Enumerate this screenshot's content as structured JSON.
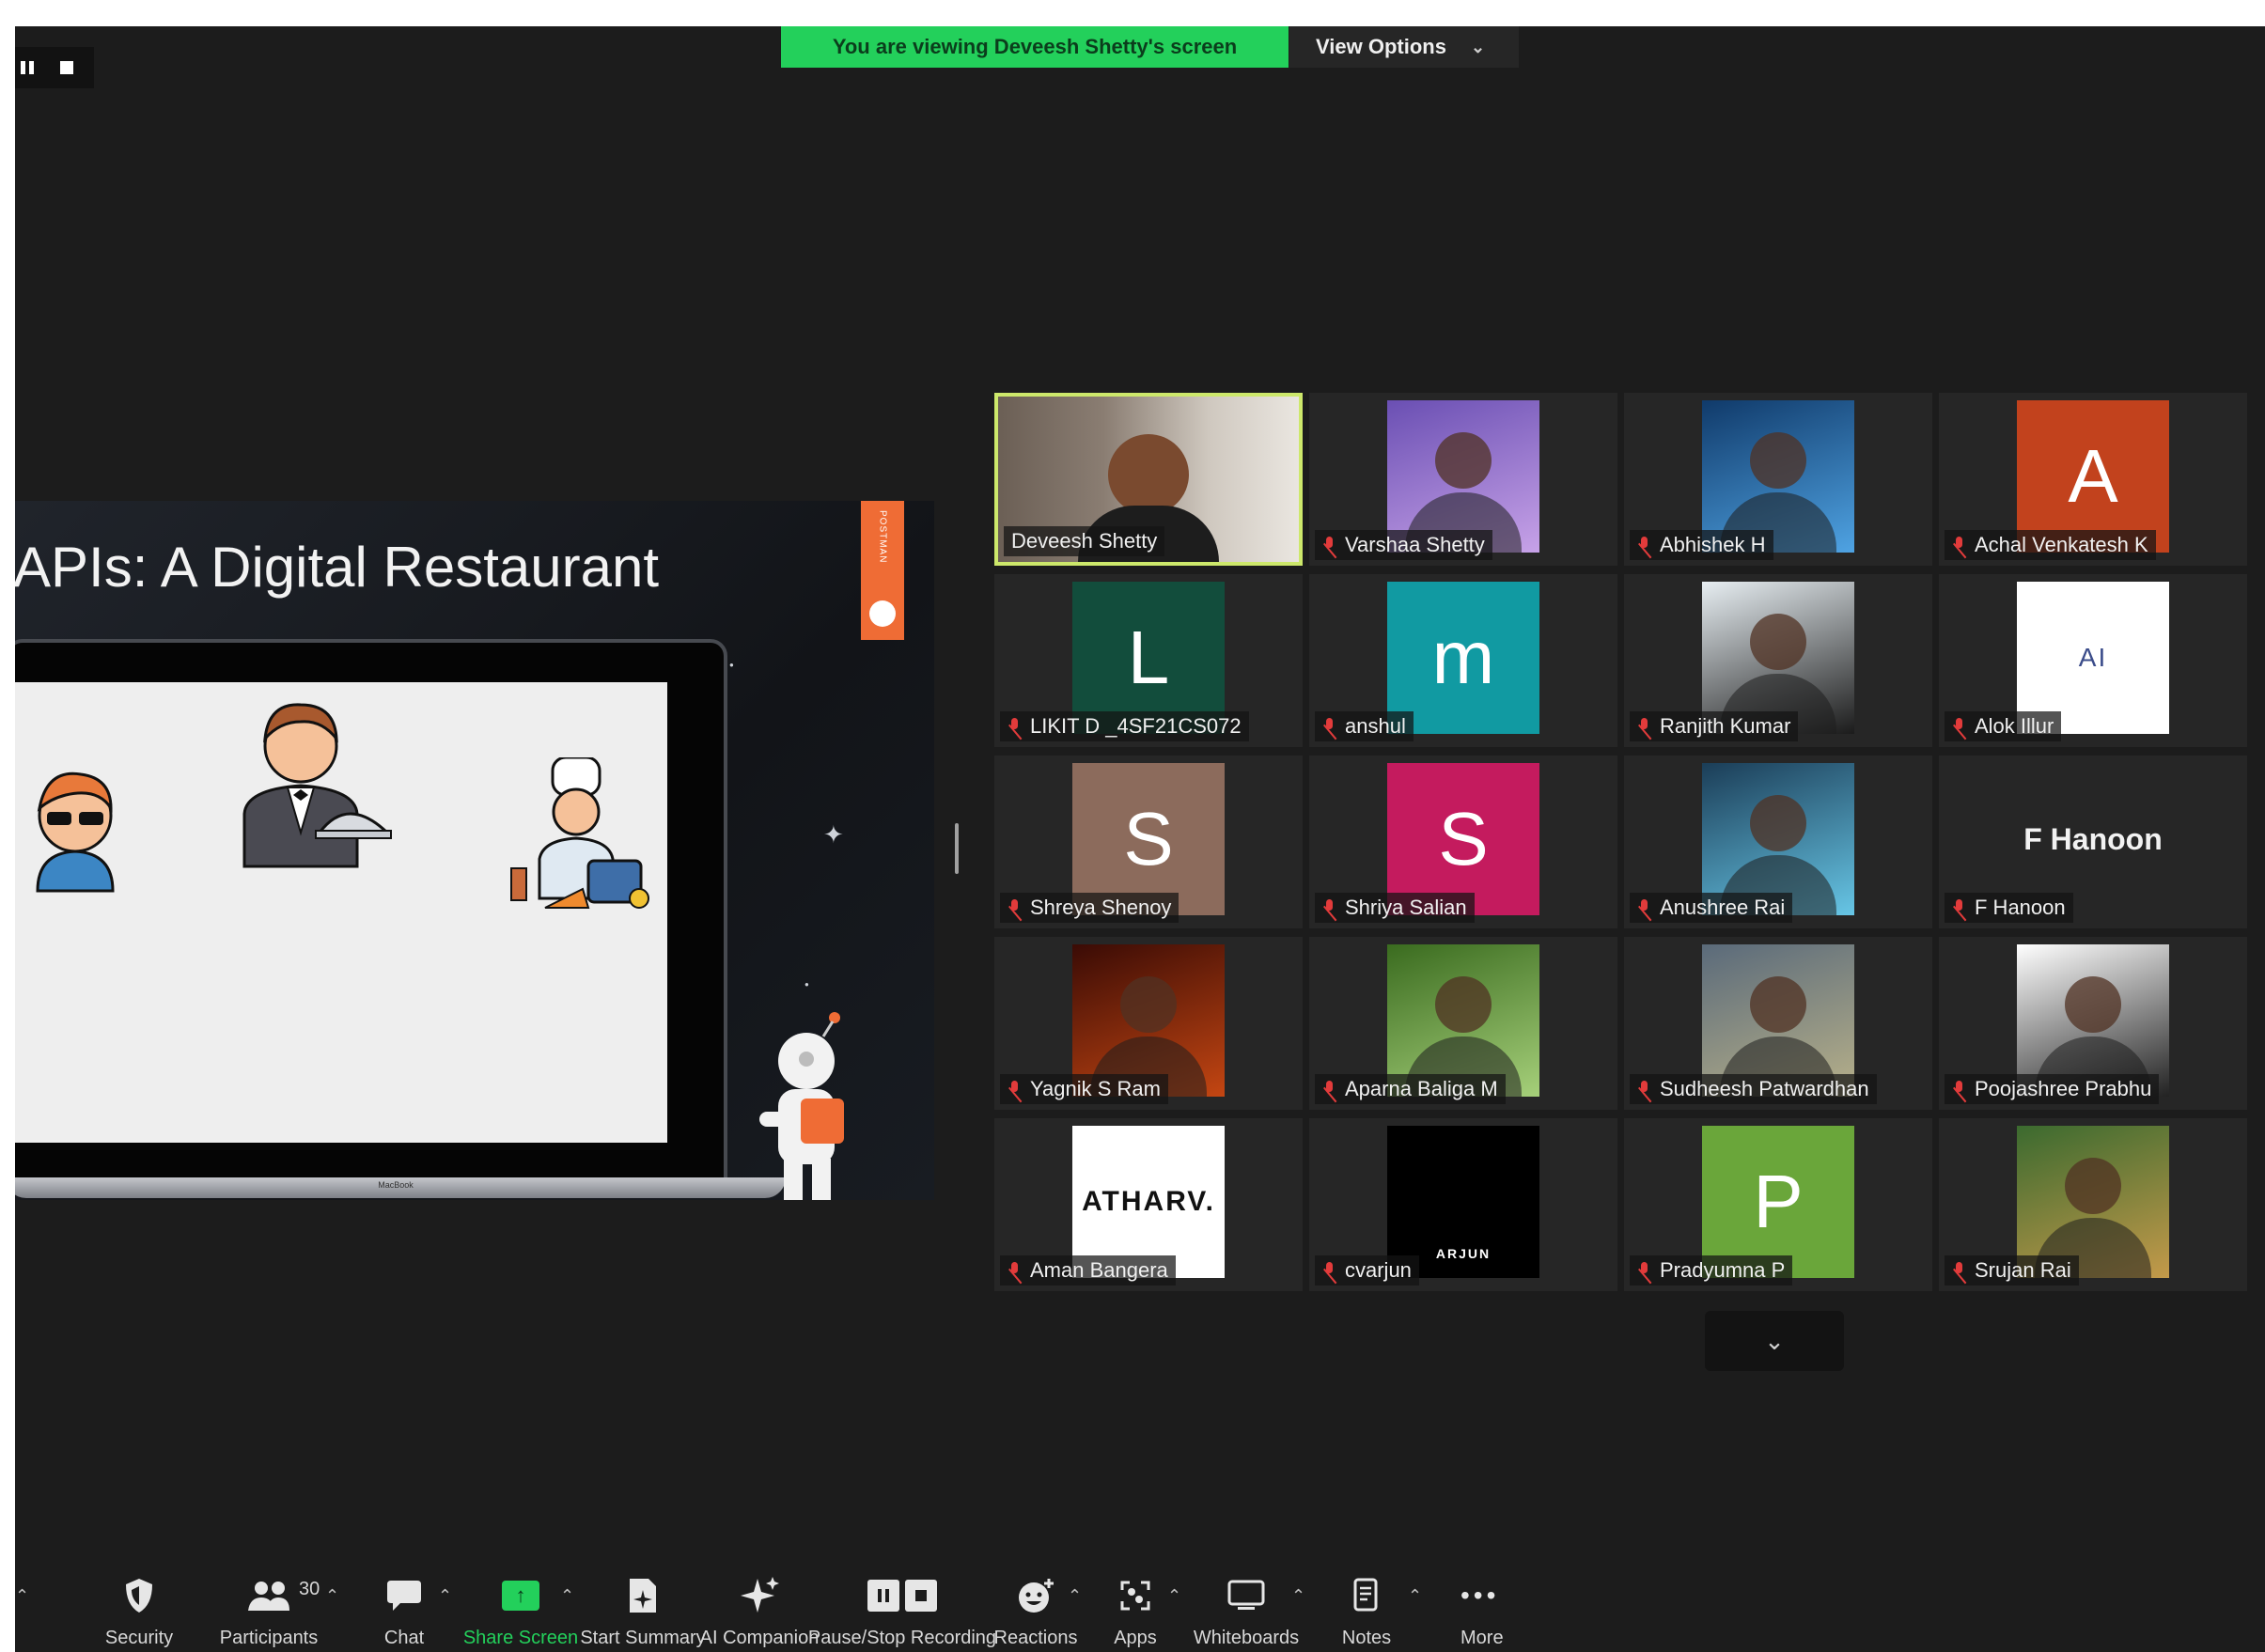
{
  "top_bar": {
    "viewing_banner": "You are viewing Deveesh Shetty's screen",
    "view_options": "View Options"
  },
  "shared_screen": {
    "slide_title": "APIs: A Digital Restaurant",
    "side_tab_text": "POSTMAN",
    "laptop_brand": "MacBook",
    "illustrations": [
      "customer-icon",
      "waiter-icon",
      "chef-icon",
      "astronaut-icon"
    ]
  },
  "gallery": {
    "participants": [
      {
        "name": "Deveesh Shetty",
        "avatar": "video",
        "active": true,
        "muted": false
      },
      {
        "name": "Varshaa Shetty",
        "avatar": "photo",
        "colors": [
          "#6a4fb3",
          "#c7a2e8"
        ],
        "muted": true
      },
      {
        "name": "Abhishek H",
        "avatar": "photo",
        "colors": [
          "#103a6a",
          "#4fa3e3"
        ],
        "muted": true
      },
      {
        "name": "Achal Venkatesh K",
        "avatar": "letter",
        "letter": "A",
        "color": "#c2421d",
        "muted": true
      },
      {
        "name": "LIKIT D _4SF21CS072",
        "avatar": "letter",
        "letter": "L",
        "color": "#124d3c",
        "muted": true
      },
      {
        "name": "anshul",
        "avatar": "letter",
        "letter": "m",
        "color": "#119aa2",
        "muted": true
      },
      {
        "name": "Ranjith Kumar",
        "avatar": "photo",
        "colors": [
          "#e7eef2",
          "#1b1b1b"
        ],
        "muted": true
      },
      {
        "name": "Alok Illur",
        "avatar": "logo",
        "logo_text": "AI",
        "color": "#ffffff",
        "muted": true
      },
      {
        "name": "Shreya Shenoy",
        "avatar": "letter",
        "letter": "S",
        "color": "#8c6b5c",
        "muted": true
      },
      {
        "name": "Shriya Salian",
        "avatar": "letter",
        "letter": "S",
        "color": "#c41b5e",
        "muted": true
      },
      {
        "name": "Anushree Rai",
        "avatar": "photo",
        "colors": [
          "#1b3d57",
          "#67c6e6"
        ],
        "muted": true
      },
      {
        "name": "F Hanoon",
        "avatar": "text",
        "display_text": "F Hanoon",
        "muted": true
      },
      {
        "name": "Yagnik S Ram",
        "avatar": "photo",
        "colors": [
          "#3a0b05",
          "#c44612"
        ],
        "muted": true
      },
      {
        "name": "Aparna Baliga M",
        "avatar": "photo",
        "colors": [
          "#3a6b1f",
          "#a6d07a"
        ],
        "muted": true
      },
      {
        "name": "Sudheesh Patwardhan",
        "avatar": "photo",
        "colors": [
          "#5a6a7a",
          "#b8b18a"
        ],
        "muted": true
      },
      {
        "name": "Poojashree Prabhu",
        "avatar": "photo",
        "colors": [
          "#ffffff",
          "#222222"
        ],
        "muted": true
      },
      {
        "name": "Aman Bangera",
        "avatar": "logo",
        "logo_text": "ATHARV.",
        "color": "#ffffff",
        "muted": true
      },
      {
        "name": "cvarjun",
        "avatar": "logo",
        "logo_text": "ARJUN",
        "color": "#000000",
        "muted": true
      },
      {
        "name": "Pradyumna P",
        "avatar": "letter",
        "letter": "P",
        "color": "#6aa63a",
        "muted": true
      },
      {
        "name": "Srujan Rai",
        "avatar": "photo",
        "colors": [
          "#3b6a2f",
          "#c49a4a"
        ],
        "muted": true
      }
    ]
  },
  "toolbar": {
    "items": [
      {
        "label": "Security",
        "icon": "shield-icon"
      },
      {
        "label": "Participants",
        "icon": "participants-icon",
        "count": "30"
      },
      {
        "label": "Chat",
        "icon": "chat-icon"
      },
      {
        "label": "Share Screen",
        "icon": "share-screen-icon"
      },
      {
        "label": "Start Summary",
        "icon": "summary-icon"
      },
      {
        "label": "AI Companion",
        "icon": "sparkle-icon"
      },
      {
        "label": "Pause/Stop Recording",
        "icon": "recording-icon"
      },
      {
        "label": "Reactions",
        "icon": "smiley-icon"
      },
      {
        "label": "Apps",
        "icon": "apps-icon"
      },
      {
        "label": "Whiteboards",
        "icon": "whiteboard-icon"
      },
      {
        "label": "Notes",
        "icon": "notes-icon"
      },
      {
        "label": "More",
        "icon": "more-icon"
      }
    ]
  },
  "colors": {
    "background": "#1c1c1c",
    "tile": "#262626",
    "banner_green": "#23d05b",
    "active_speaker_border": "#cde86b",
    "muted_red": "#e23b3b",
    "postman_orange": "#ef6c35"
  }
}
